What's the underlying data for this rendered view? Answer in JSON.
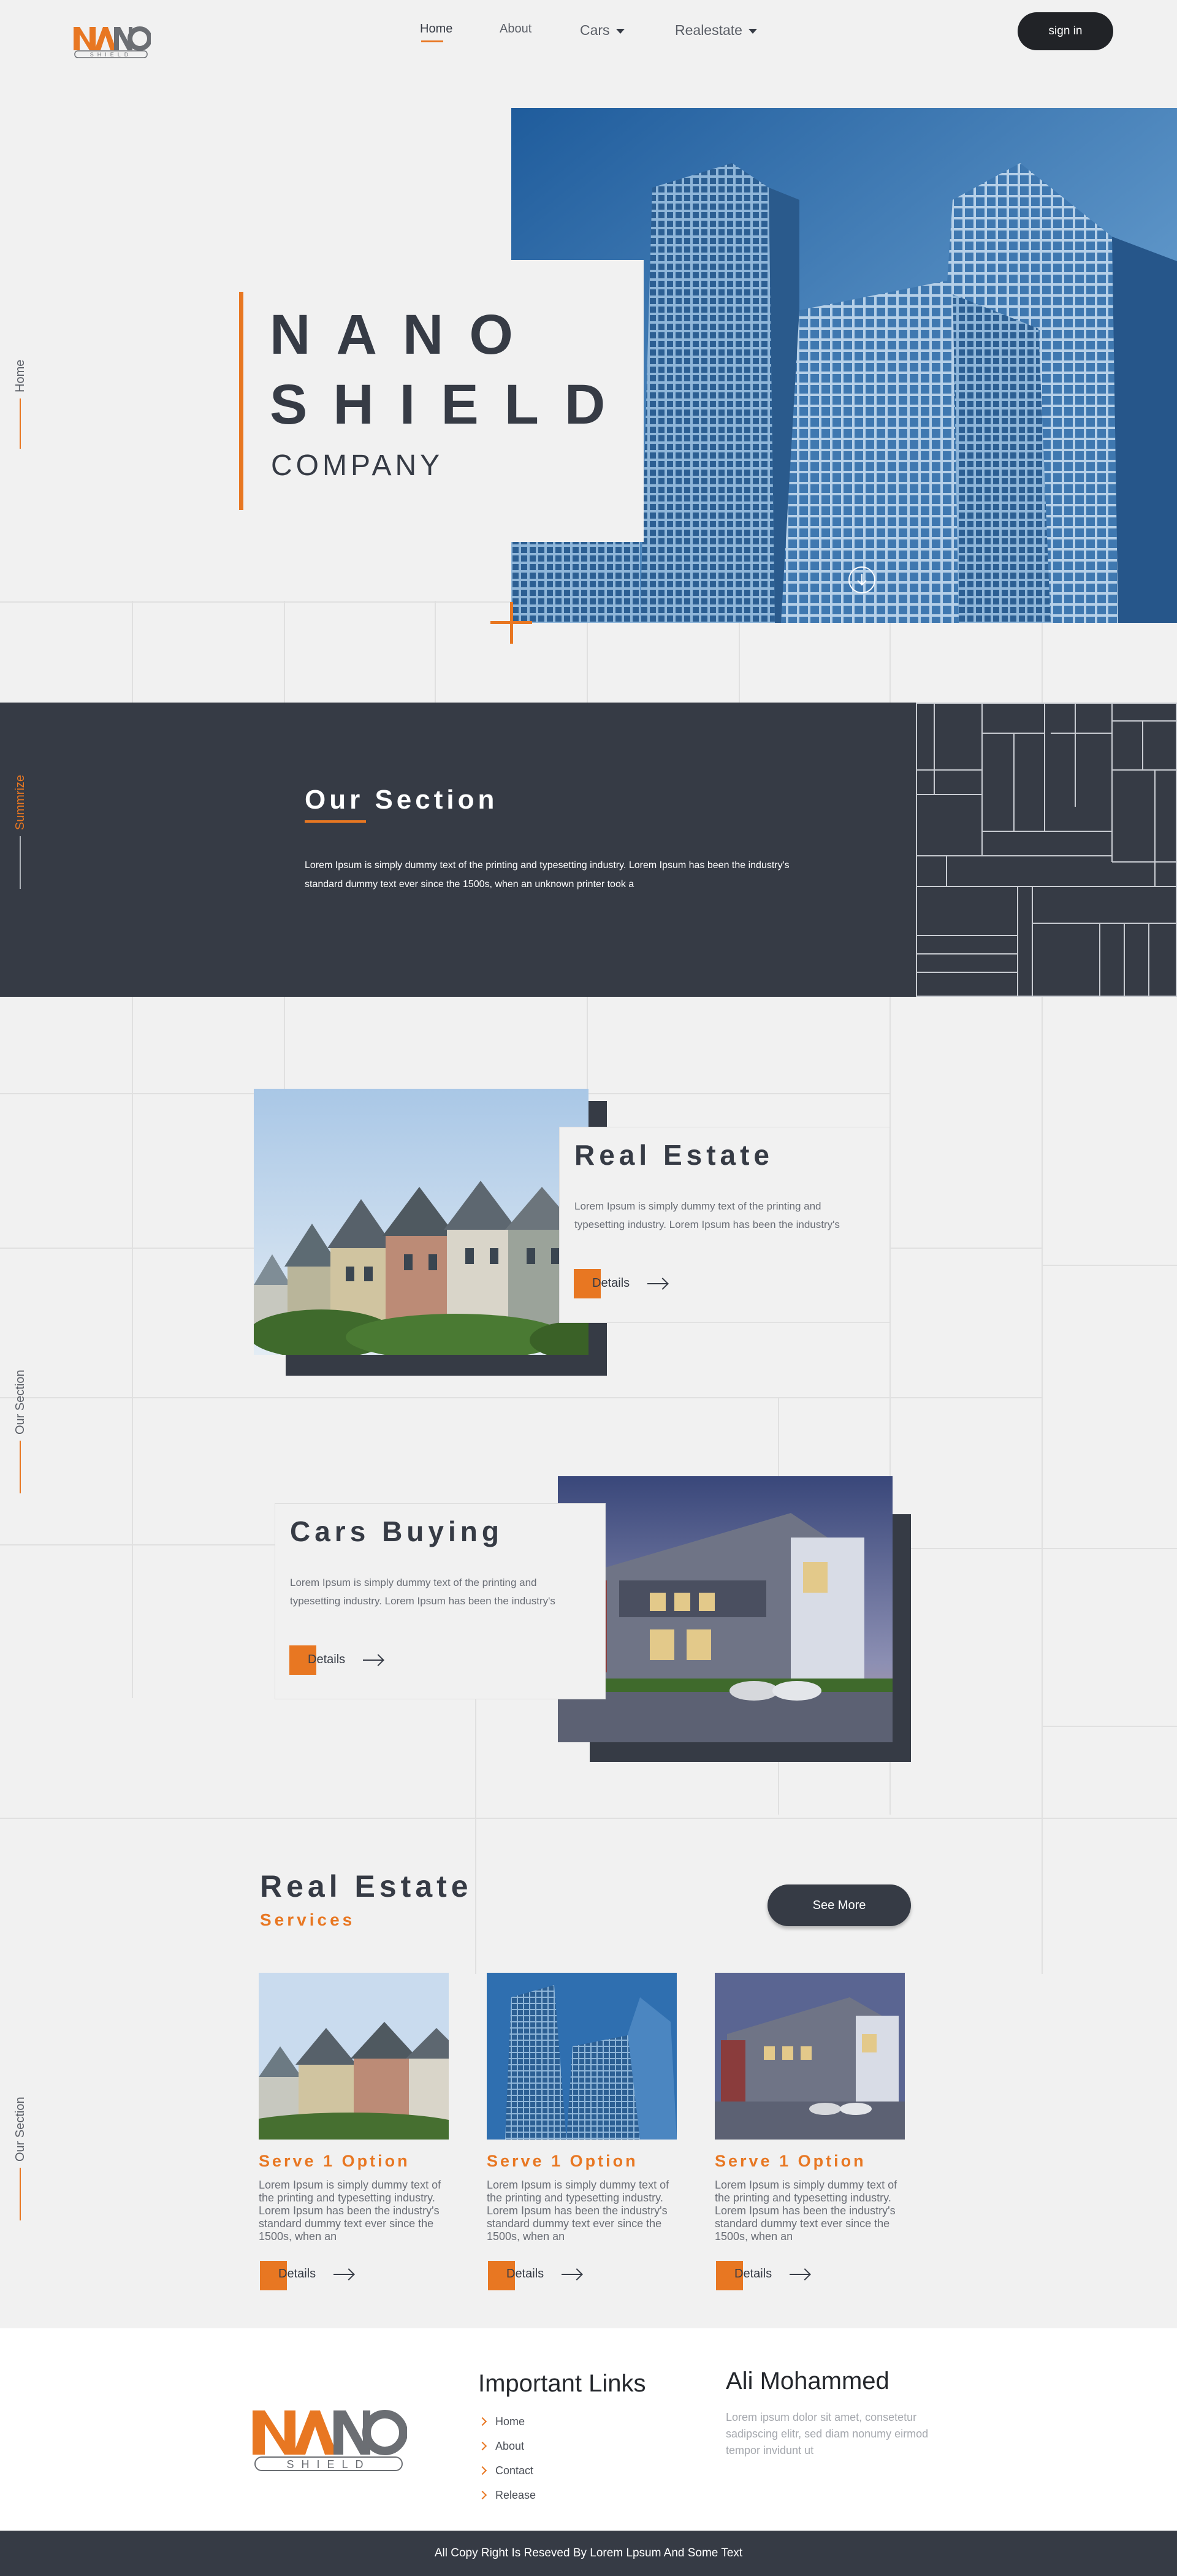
{
  "header": {
    "logo_top": "NANO",
    "logo_bottom": "SHIELD",
    "nav": [
      {
        "label": "Home",
        "active": true
      },
      {
        "label": "About"
      },
      {
        "label": "Cars"
      },
      {
        "label": "Realestate"
      }
    ],
    "signin_label": "sign in"
  },
  "hero": {
    "line1": "NANO",
    "line2": "SHIELD",
    "line3": "COMPANY",
    "side_label": "Home"
  },
  "summary": {
    "side_label": "Summrize",
    "title": "Our Section",
    "text": "Lorem Ipsum is simply dummy text of the printing and typesetting industry. Lorem Ipsum has been the industry's standard dummy text ever since the 1500s, when an unknown printer took a"
  },
  "features": {
    "side_label": "Our Section",
    "items": [
      {
        "title": "Real Estate",
        "text": "Lorem Ipsum is simply dummy text of the printing and typesetting industry. Lorem Ipsum has been the industry's",
        "details_label": "Details"
      },
      {
        "title": "Cars Buying",
        "text": "Lorem Ipsum is simply dummy text of the printing and typesetting industry. Lorem Ipsum has been the industry's",
        "details_label": "Details"
      }
    ]
  },
  "services": {
    "side_label": "Our Section",
    "title": "Real Estate",
    "subtitle": "Services",
    "see_more_label": "See More",
    "items": [
      {
        "title": "Serve 1 Option",
        "text": "Lorem Ipsum is simply dummy text of the printing and typesetting industry. Lorem Ipsum has been the industry's standard dummy text ever since the 1500s, when an",
        "details_label": "Details"
      },
      {
        "title": "Serve 1 Option",
        "text": "Lorem Ipsum is simply dummy text of the printing and typesetting industry. Lorem Ipsum has been the industry's standard dummy text ever since the 1500s, when an",
        "details_label": "Details"
      },
      {
        "title": "Serve 1 Option",
        "text": "Lorem Ipsum is simply dummy text of the printing and typesetting industry. Lorem Ipsum has been the industry's standard dummy text ever since the 1500s, when an",
        "details_label": "Details"
      }
    ]
  },
  "footer": {
    "links_title": "Important Links",
    "links": [
      "Home",
      "About",
      "Contact",
      "Release"
    ],
    "author_name": "Ali Mohammed",
    "author_text": "Lorem ipsum dolor sit amet, consetetur sadipscing elitr, sed diam nonumy eirmod tempor invidunt ut",
    "copyright": "All Copy Right Is Reseved By Lorem Lpsum And Some Text"
  },
  "colors": {
    "accent": "#e87722",
    "dark": "#363b45",
    "background": "#f1f1f1"
  }
}
